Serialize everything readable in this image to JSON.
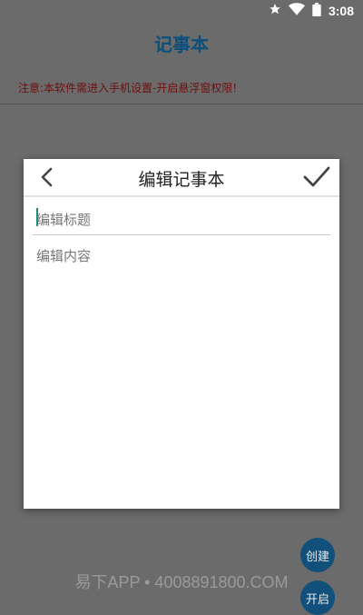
{
  "status_bar": {
    "time": "3:08",
    "icons": [
      "star-icon",
      "wifi-icon",
      "battery-icon"
    ]
  },
  "app": {
    "title": "记事本",
    "notice": "注意:本软件需进入手机设置-开启悬浮窗权限!"
  },
  "dialog": {
    "title": "编辑记事本",
    "back_icon": "chevron-left-icon",
    "confirm_icon": "check-icon",
    "title_field": {
      "value": "",
      "placeholder": "编辑标题"
    },
    "content_field": {
      "value": "",
      "placeholder": "编辑内容"
    }
  },
  "floating_buttons": {
    "create_label": "创建",
    "open_label": "开启"
  },
  "watermark": "易下APP • 4008891800.COM",
  "colors": {
    "overlay": "#6b6b6b",
    "app_title": "#0b4f7a",
    "notice": "#6e0f0f",
    "fab": "#10507a"
  }
}
